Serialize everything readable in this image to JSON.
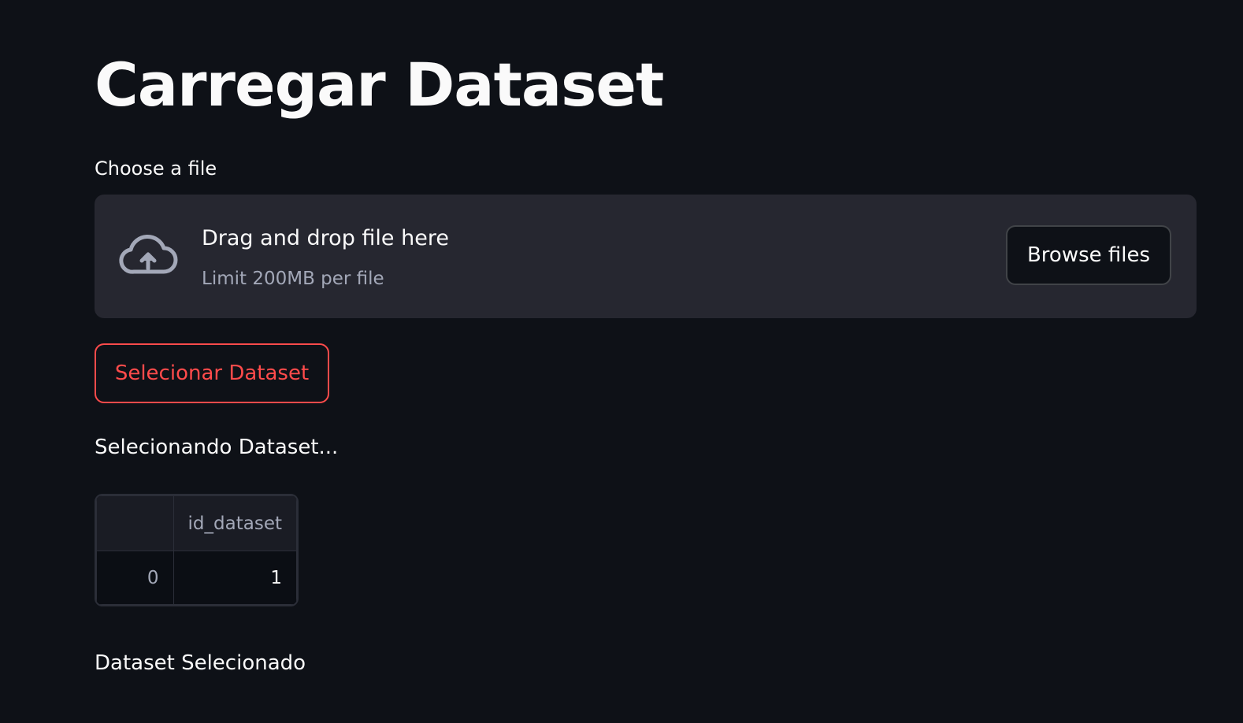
{
  "page": {
    "title": "Carregar Dataset"
  },
  "uploader": {
    "label": "Choose a file",
    "drop_title": "Drag and drop file here",
    "limit_text": "Limit 200MB per file",
    "browse_label": "Browse files",
    "icon": "cloud-upload-icon"
  },
  "select_button": {
    "label": "Selecionar Dataset",
    "color": "#ff4b4b"
  },
  "status": {
    "selecting": "Selecionando Dataset...",
    "selected": "Dataset Selecionado"
  },
  "dataframe": {
    "columns": [
      "",
      "id_dataset"
    ],
    "rows": [
      {
        "index": "0",
        "id_dataset": "1"
      }
    ]
  },
  "theme": {
    "background": "#0e1117",
    "surface": "#262730",
    "accent": "#ff4b4b"
  }
}
